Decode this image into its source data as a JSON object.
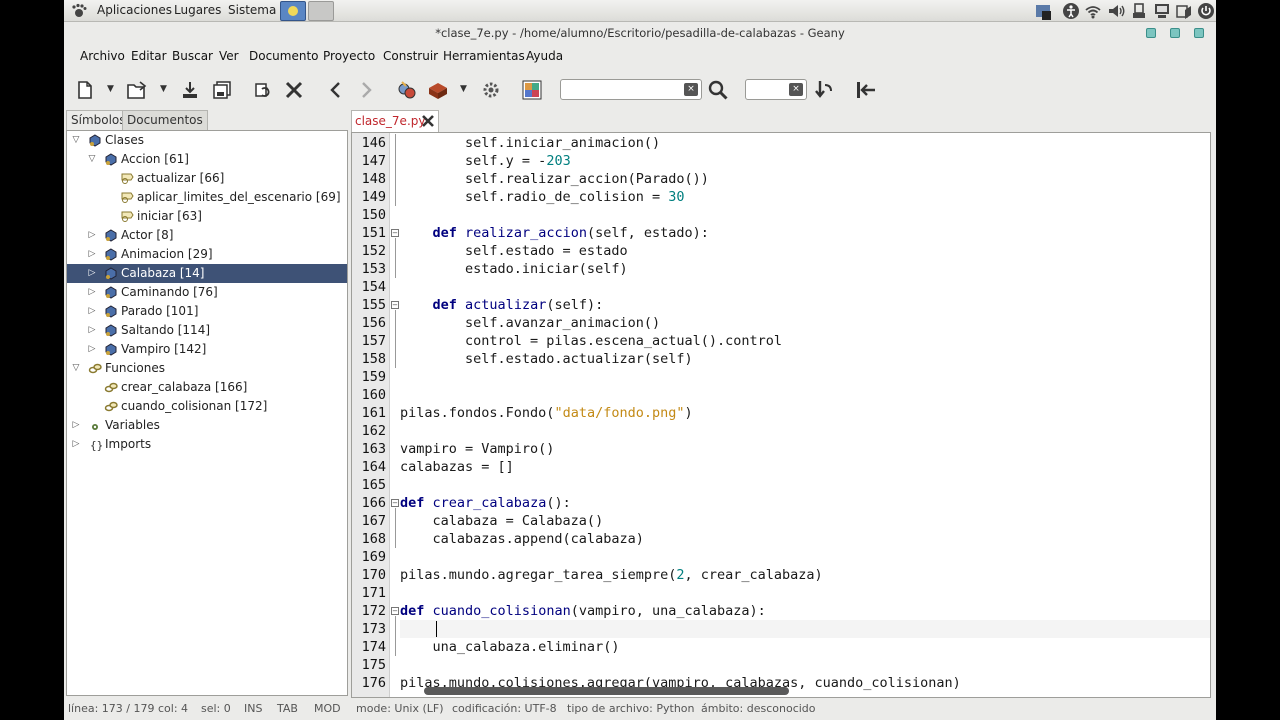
{
  "panel": {
    "menus": [
      "Aplicaciones",
      "Lugares",
      "Sistema"
    ],
    "tray_icons": [
      "update-icon",
      "accessibility-icon",
      "network-icon",
      "volume-icon",
      "usb-icon",
      "display-icon",
      "battery-icon",
      "window-icon",
      "power-icon"
    ]
  },
  "window": {
    "title": "*clase_7e.py - /home/alumno/Escritorio/pesadilla-de-calabazas - Geany"
  },
  "menubar": [
    "Archivo",
    "Editar",
    "Buscar",
    "Ver",
    "Documento",
    "Proyecto",
    "Construir",
    "Herramientas",
    "Ayuda"
  ],
  "sidebar": {
    "tabs": [
      "Símbolos",
      "Documentos"
    ],
    "tree": [
      {
        "label": "Clases",
        "level": 0,
        "expanded": true,
        "icon": "class-icon"
      },
      {
        "label": "Accion [61]",
        "level": 1,
        "expanded": true,
        "icon": "class-icon"
      },
      {
        "label": "actualizar [66]",
        "level": 2,
        "icon": "method-icon"
      },
      {
        "label": "aplicar_limites_del_escenario [69]",
        "level": 2,
        "icon": "method-icon"
      },
      {
        "label": "iniciar [63]",
        "level": 2,
        "icon": "method-icon"
      },
      {
        "label": "Actor [8]",
        "level": 1,
        "expanded": false,
        "icon": "class-icon"
      },
      {
        "label": "Animacion [29]",
        "level": 1,
        "expanded": false,
        "icon": "class-icon"
      },
      {
        "label": "Calabaza [14]",
        "level": 1,
        "expanded": false,
        "icon": "class-icon",
        "selected": true
      },
      {
        "label": "Caminando [76]",
        "level": 1,
        "expanded": false,
        "icon": "class-icon"
      },
      {
        "label": "Parado [101]",
        "level": 1,
        "expanded": false,
        "icon": "class-icon"
      },
      {
        "label": "Saltando [114]",
        "level": 1,
        "expanded": false,
        "icon": "class-icon"
      },
      {
        "label": "Vampiro [142]",
        "level": 1,
        "expanded": false,
        "icon": "class-icon"
      },
      {
        "label": "Funciones",
        "level": 0,
        "expanded": true,
        "icon": "function-icon"
      },
      {
        "label": "crear_calabaza [166]",
        "level": 1,
        "icon": "function-icon"
      },
      {
        "label": "cuando_colisionan [172]",
        "level": 1,
        "icon": "function-icon"
      },
      {
        "label": "Variables",
        "level": 0,
        "expanded": false,
        "icon": "variable-icon"
      },
      {
        "label": "Imports",
        "level": 0,
        "expanded": false,
        "icon": "import-icon"
      }
    ]
  },
  "editor": {
    "tab_label": "clase_7e.py",
    "current_line": 173,
    "lines": [
      {
        "n": "146",
        "code": "        self.iniciar_animacion()"
      },
      {
        "n": "147",
        "code": "        self.y = -203"
      },
      {
        "n": "148",
        "code": "        self.realizar_accion(Parado())"
      },
      {
        "n": "149",
        "code": "        self.radio_de_colision = 30"
      },
      {
        "n": "150",
        "code": ""
      },
      {
        "n": "151",
        "code": "    def realizar_accion(self, estado):"
      },
      {
        "n": "152",
        "code": "        self.estado = estado"
      },
      {
        "n": "153",
        "code": "        estado.iniciar(self)"
      },
      {
        "n": "154",
        "code": ""
      },
      {
        "n": "155",
        "code": "    def actualizar(self):"
      },
      {
        "n": "156",
        "code": "        self.avanzar_animacion()"
      },
      {
        "n": "157",
        "code": "        control = pilas.escena_actual().control"
      },
      {
        "n": "158",
        "code": "        self.estado.actualizar(self)"
      },
      {
        "n": "159",
        "code": ""
      },
      {
        "n": "160",
        "code": ""
      },
      {
        "n": "161",
        "code": "pilas.fondos.Fondo(\"data/fondo.png\")"
      },
      {
        "n": "162",
        "code": ""
      },
      {
        "n": "163",
        "code": "vampiro = Vampiro()"
      },
      {
        "n": "164",
        "code": "calabazas = []"
      },
      {
        "n": "165",
        "code": ""
      },
      {
        "n": "166",
        "code": "def crear_calabaza():"
      },
      {
        "n": "167",
        "code": "    calabaza = Calabaza()"
      },
      {
        "n": "168",
        "code": "    calabazas.append(calabaza)"
      },
      {
        "n": "169",
        "code": ""
      },
      {
        "n": "170",
        "code": "pilas.mundo.agregar_tarea_siempre(2, crear_calabaza)"
      },
      {
        "n": "171",
        "code": ""
      },
      {
        "n": "172",
        "code": "def cuando_colisionan(vampiro, una_calabaza):"
      },
      {
        "n": "173",
        "code": "    "
      },
      {
        "n": "174",
        "code": "    una_calabaza.eliminar()"
      },
      {
        "n": "175",
        "code": ""
      },
      {
        "n": "176",
        "code": "pilas.mundo.colisiones.agregar(vampiro, calabazas, cuando_colisionan)"
      }
    ]
  },
  "status": {
    "line": "línea: 173 / 179",
    "col": "col: 4",
    "sel": "sel: 0",
    "ins": "INS",
    "tab": "TAB",
    "mod": "MOD",
    "mode": "mode: Unix (LF)",
    "encoding": "codificación: UTF-8",
    "filetype": "tipo de archivo: Python",
    "scope": "ámbito: desconocido"
  },
  "colors": {
    "selection": "#3e5276",
    "keyword": "#00007f",
    "number": "#007f7f",
    "string": "#c38a16",
    "tab_label": "#c0272d"
  }
}
